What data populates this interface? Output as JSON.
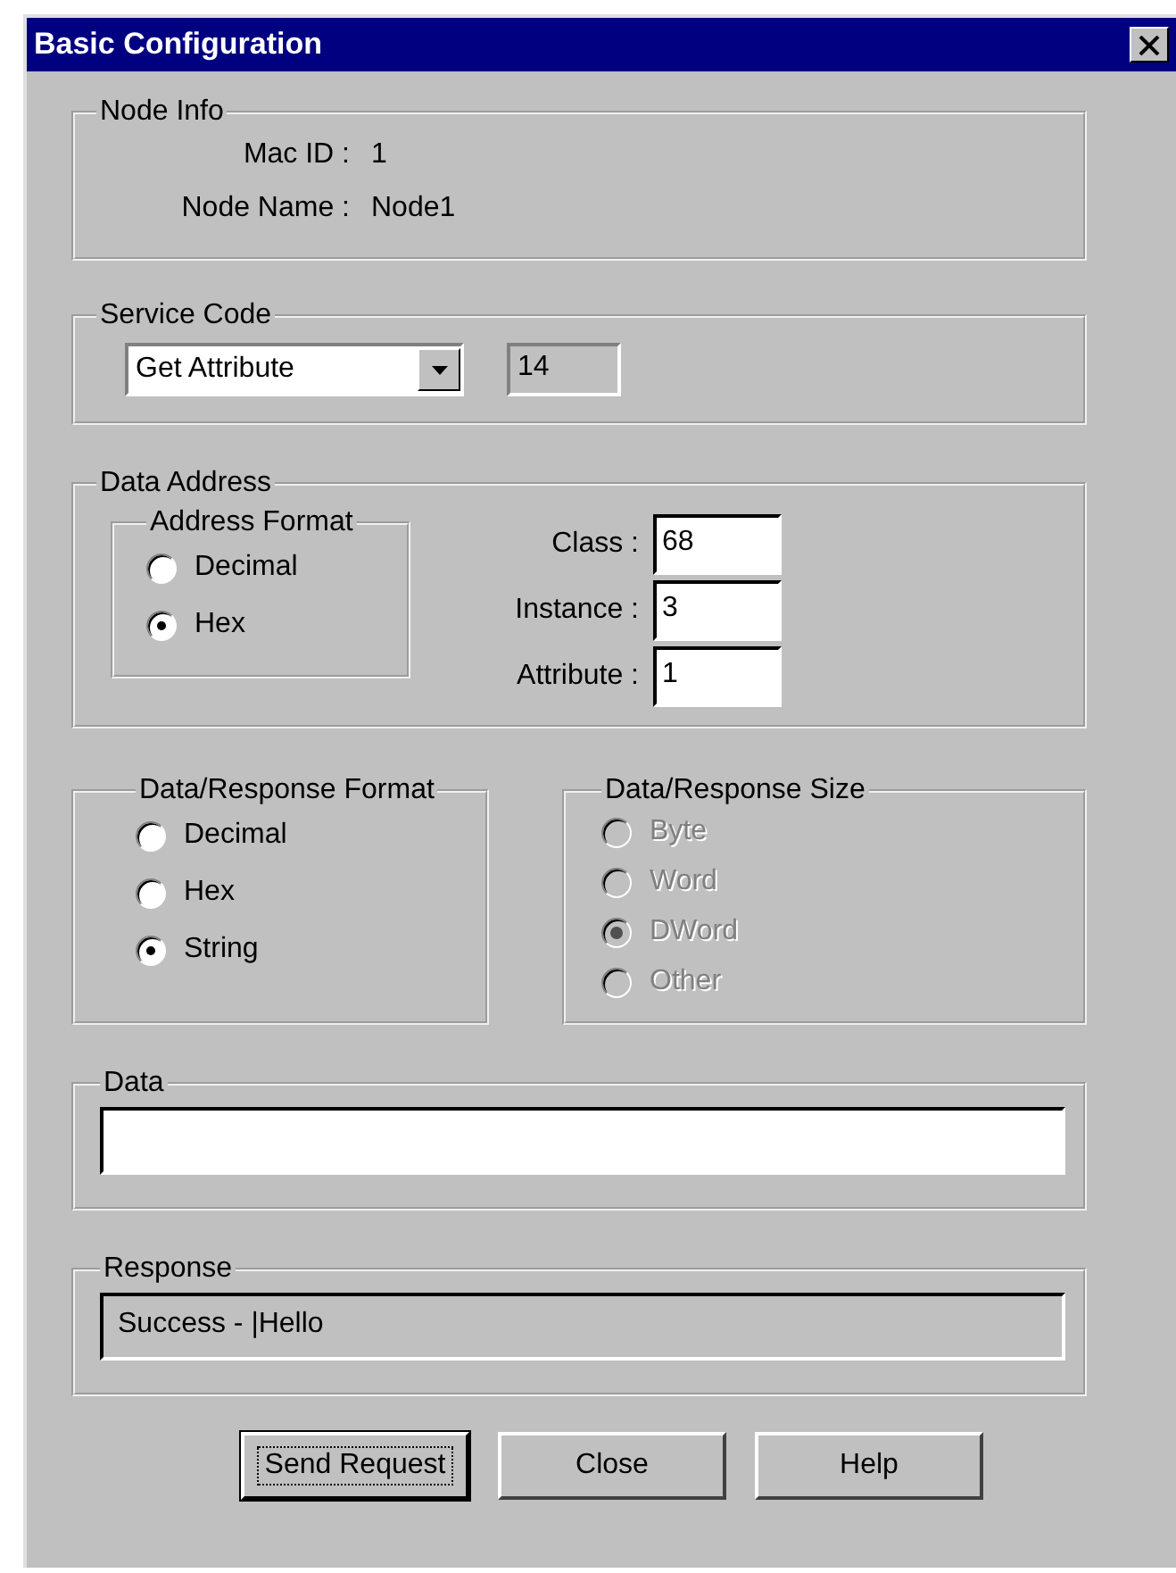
{
  "window": {
    "title": "Basic Configuration"
  },
  "node_info": {
    "title": "Node Info",
    "fields": [
      {
        "label": "Mac ID :",
        "value": "1"
      },
      {
        "label": "Node Name :",
        "value": "Node1"
      }
    ]
  },
  "service_code": {
    "title": "Service Code",
    "dropdown": {
      "value": "Get Attribute"
    },
    "code": {
      "value": "14",
      "disabled": true
    }
  },
  "data_address": {
    "title": "Data Address",
    "address_format": {
      "title": "Address Format",
      "options": [
        {
          "label": "Decimal",
          "selected": false
        },
        {
          "label": "Hex",
          "selected": true
        }
      ]
    },
    "fields": [
      {
        "label": "Class :",
        "value": "68"
      },
      {
        "label": "Instance :",
        "value": "3"
      },
      {
        "label": "Attribute :",
        "value": "1"
      }
    ]
  },
  "response_format": {
    "title": "Data/Response Format",
    "disabled": false,
    "options": [
      {
        "label": "Decimal",
        "selected": false
      },
      {
        "label": "Hex",
        "selected": false
      },
      {
        "label": "String",
        "selected": true
      }
    ]
  },
  "response_size": {
    "title": "Data/Response Size",
    "disabled": true,
    "options": [
      {
        "label": "Byte",
        "selected": false
      },
      {
        "label": "Word",
        "selected": false
      },
      {
        "label": "DWord",
        "selected": true
      },
      {
        "label": "Other",
        "selected": false
      }
    ]
  },
  "data": {
    "title": "Data"
  },
  "response": {
    "title": "Response",
    "value": "Success - |Hello"
  },
  "buttons": [
    {
      "label": "Send Request",
      "focused": true
    },
    {
      "label": "Close",
      "focused": false
    },
    {
      "label": "Help",
      "focused": false
    }
  ]
}
